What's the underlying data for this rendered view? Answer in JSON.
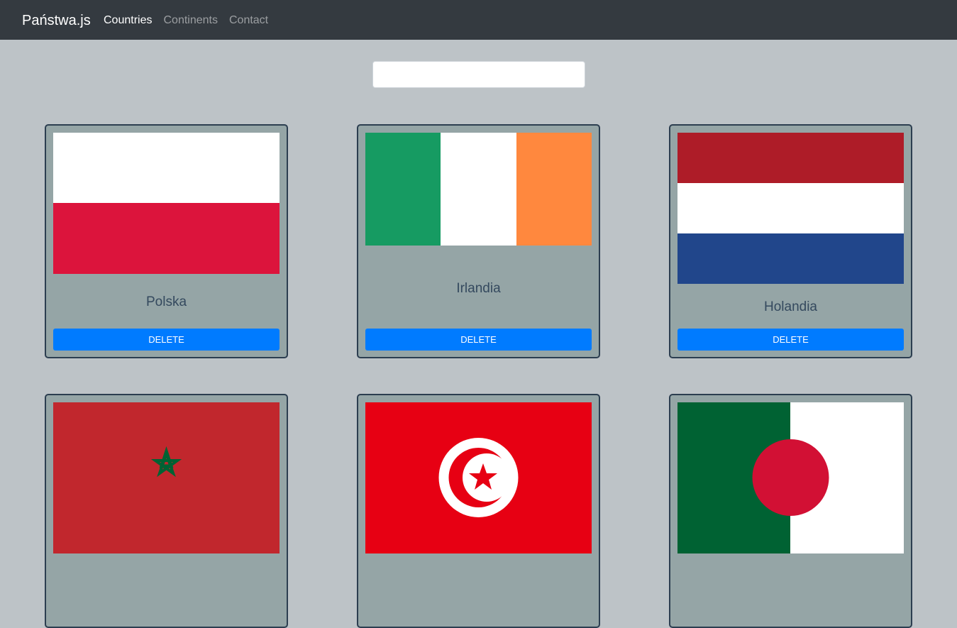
{
  "navbar": {
    "brand": "Państwa.js",
    "links": [
      {
        "label": "Countries",
        "active": true
      },
      {
        "label": "Continents",
        "active": false
      },
      {
        "label": "Contact",
        "active": false
      }
    ]
  },
  "search": {
    "value": "",
    "placeholder": ""
  },
  "cards": [
    {
      "name": "Polska",
      "button": "DELETE",
      "flag_colors": [
        "#ffffff",
        "#dc143c"
      ]
    },
    {
      "name": "Irlandia",
      "button": "DELETE",
      "flag_colors": [
        "#169b62",
        "#ffffff",
        "#ff883e"
      ]
    },
    {
      "name": "Holandia",
      "button": "DELETE",
      "flag_colors": [
        "#ae1c28",
        "#ffffff",
        "#21468b"
      ]
    },
    {
      "name": "",
      "button": "",
      "flag_colors": [
        "#c1272d",
        "#006233"
      ]
    },
    {
      "name": "",
      "button": "",
      "flag_colors": [
        "#e70013",
        "#ffffff"
      ]
    },
    {
      "name": "",
      "button": "",
      "flag_colors": [
        "#006233",
        "#ffffff",
        "#d21034"
      ]
    }
  ]
}
